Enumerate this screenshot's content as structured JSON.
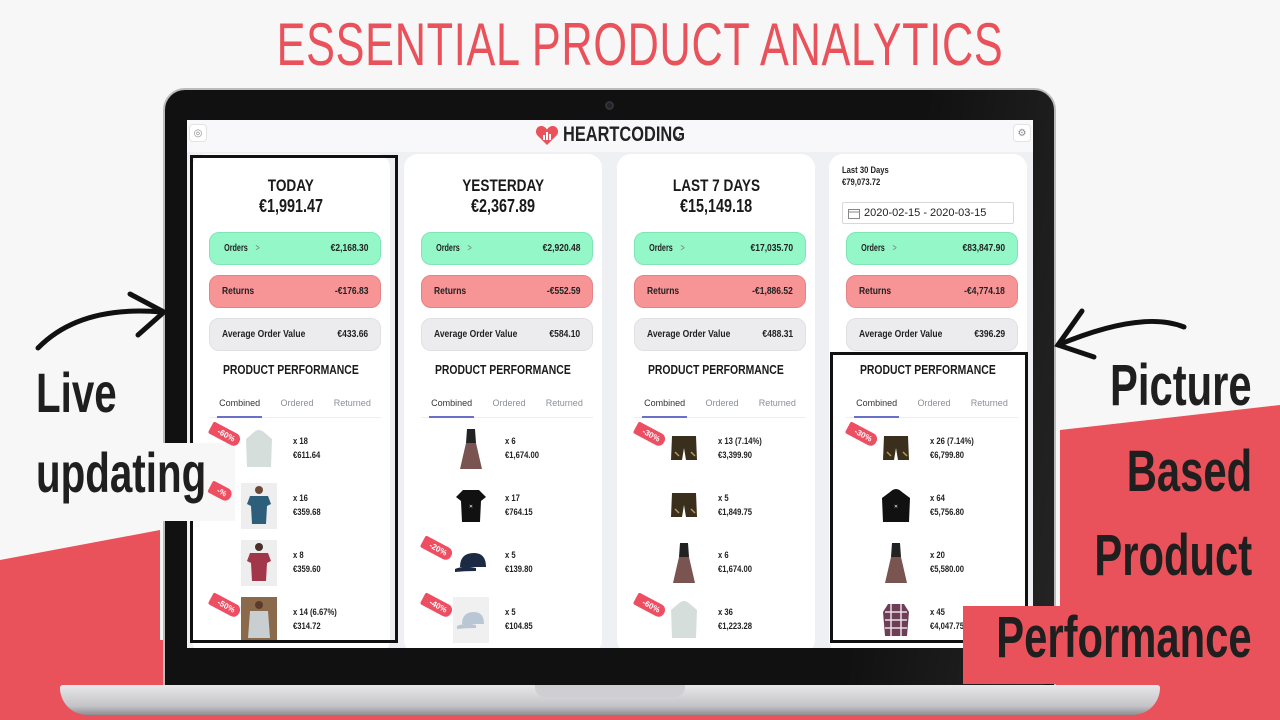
{
  "headline": "ESSENTIAL PRODUCT ANALYTICS",
  "colors": {
    "brand_red": "#e9525a",
    "orders_green": "#94f7c8",
    "returns_red": "#f79496",
    "aov_gray": "#ececee",
    "tab_underline": "#6a6fc9",
    "badge_red": "#ee4e62"
  },
  "app": {
    "brand": "HEARTCODING",
    "brand_icon": "heart-chart-icon",
    "left_icon": "user-icon",
    "right_icon": "gear-icon"
  },
  "captions": {
    "left": [
      "Live",
      "updating"
    ],
    "right": [
      "Picture",
      "Based",
      "Product",
      "Performance"
    ]
  },
  "cards": [
    {
      "title": "TODAY",
      "total": "€1,991.47",
      "orders_label": "Orders",
      "orders_value": "€2,168.30",
      "returns_label": "Returns",
      "returns_value": "-€176.83",
      "aov_label": "Average Order Value",
      "aov_value": "€433.66",
      "pp_title": "PRODUCT PERFORMANCE",
      "tabs": [
        "Combined",
        "Ordered",
        "Returned"
      ],
      "products": [
        {
          "image": "hoodie-light",
          "badge": "-60%",
          "qty": "x 18",
          "revenue": "€611.64"
        },
        {
          "image": "tshirt-blue-model",
          "badge": "-%",
          "qty": "x 16",
          "revenue": "€359.68"
        },
        {
          "image": "tshirt-red-model",
          "badge": "",
          "qty": "x 8",
          "revenue": "€359.60"
        },
        {
          "image": "shirt-plaid-model",
          "badge": "-50%",
          "qty": "x 14 (6.67%)",
          "revenue": "€314.72"
        }
      ]
    },
    {
      "title": "YESTERDAY",
      "total": "€2,367.89",
      "orders_label": "Orders",
      "orders_value": "€2,920.48",
      "returns_label": "Returns",
      "returns_value": "-€552.59",
      "aov_label": "Average Order Value",
      "aov_value": "€584.10",
      "pp_title": "PRODUCT PERFORMANCE",
      "tabs": [
        "Combined",
        "Ordered",
        "Returned"
      ],
      "products": [
        {
          "image": "dirndl",
          "badge": "",
          "qty": "x 6",
          "revenue": "€1,674.00"
        },
        {
          "image": "tshirt-black",
          "badge": "",
          "qty": "x 17",
          "revenue": "€764.15"
        },
        {
          "image": "cap-navy",
          "badge": "-20%",
          "qty": "x 5",
          "revenue": "€139.80"
        },
        {
          "image": "cap-light",
          "badge": "-40%",
          "qty": "x 5",
          "revenue": "€104.85"
        }
      ]
    },
    {
      "title": "LAST 7 DAYS",
      "total": "€15,149.18",
      "orders_label": "Orders",
      "orders_value": "€17,035.70",
      "returns_label": "Returns",
      "returns_value": "-€1,886.52",
      "aov_label": "Average Order Value",
      "aov_value": "€488.31",
      "pp_title": "PRODUCT PERFORMANCE",
      "tabs": [
        "Combined",
        "Ordered",
        "Returned"
      ],
      "products": [
        {
          "image": "lederhosen",
          "badge": "-30%",
          "qty": "x 13 (7.14%)",
          "revenue": "€3,399.90"
        },
        {
          "image": "lederhosen",
          "badge": "",
          "qty": "x 5",
          "revenue": "€1,849.75"
        },
        {
          "image": "dirndl",
          "badge": "",
          "qty": "x 6",
          "revenue": "€1,674.00"
        },
        {
          "image": "hoodie-light",
          "badge": "-60%",
          "qty": "x 36",
          "revenue": "€1,223.28"
        }
      ]
    },
    {
      "small_title": "Last 30 Days",
      "small_total": "€79,073.72",
      "date_range": "2020-02-15 - 2020-03-15",
      "orders_label": "Orders",
      "orders_value": "€83,847.90",
      "returns_label": "Returns",
      "returns_value": "-€4,774.18",
      "aov_label": "Average Order Value",
      "aov_value": "€396.29",
      "pp_title": "PRODUCT PERFORMANCE",
      "tabs": [
        "Combined",
        "Ordered",
        "Returned"
      ],
      "products": [
        {
          "image": "lederhosen",
          "badge": "-30%",
          "qty": "x 26 (7.14%)",
          "revenue": "€6,799.80"
        },
        {
          "image": "hoodie-black",
          "badge": "",
          "qty": "x 64",
          "revenue": "€5,756.80"
        },
        {
          "image": "dirndl",
          "badge": "",
          "qty": "x 20",
          "revenue": "€5,580.00"
        },
        {
          "image": "shirt-plaid",
          "badge": "",
          "qty": "x 45",
          "revenue": "€4,047.75"
        }
      ]
    }
  ]
}
